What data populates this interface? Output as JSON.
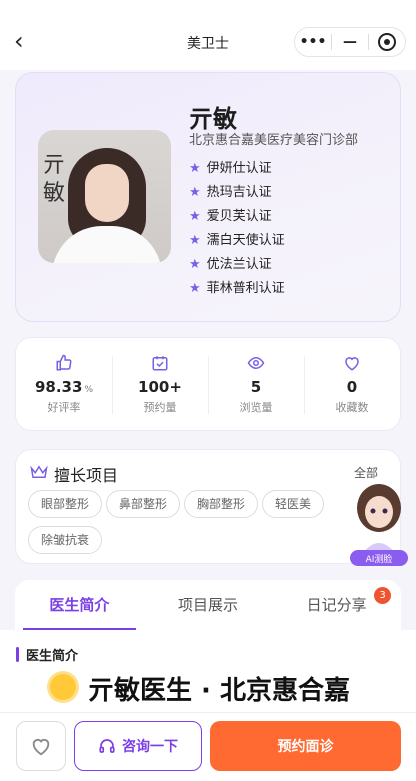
{
  "nav": {
    "title": "美卫士",
    "more_label": "•••",
    "minus_label": "—"
  },
  "profile": {
    "name": "亓敏",
    "hospital": "北京惠合嘉美医疗美容门诊部",
    "photo_sign": "亓敏",
    "certs": [
      "伊妍仕认证",
      "热玛吉认证",
      "爱贝芙认证",
      "濡白天使认证",
      "优法兰认证",
      "菲林普利认证"
    ]
  },
  "stats": [
    {
      "value": "98.33",
      "unit": "%",
      "label": "好评率",
      "icon": "thumb-up-icon"
    },
    {
      "value": "100+",
      "unit": "",
      "label": "预约量",
      "icon": "calendar-icon"
    },
    {
      "value": "5",
      "unit": "",
      "label": "浏览量",
      "icon": "eye-icon"
    },
    {
      "value": "0",
      "unit": "",
      "label": "收藏数",
      "icon": "heart-icon"
    }
  ],
  "skills": {
    "title": "擅长项目",
    "all_label": "全部",
    "tags": [
      "眼部整形",
      "鼻部整形",
      "胸部整形",
      "轻医美",
      "除皱抗衰"
    ]
  },
  "ai_label": "AI测脸",
  "tabs": [
    {
      "label": "医生简介",
      "active": true
    },
    {
      "label": "项目展示",
      "active": false
    },
    {
      "label": "日记分享",
      "active": false,
      "badge": "3"
    }
  ],
  "intro": {
    "section_title": "医生简介",
    "headline": "亓敏医生 · 北京惠合嘉"
  },
  "bottom": {
    "consult_label": "咨询一下",
    "book_label": "预约面诊"
  },
  "colors": {
    "accent": "#7b3fe4",
    "primary_button": "#ff6a33",
    "star": "#7b5ee6"
  }
}
